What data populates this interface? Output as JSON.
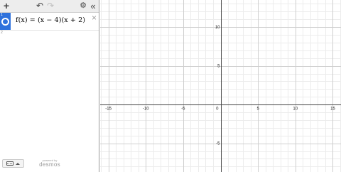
{
  "toolbar": {
    "add_icon": "plus-icon",
    "undo_icon": "undo-icon",
    "redo_icon": "redo-icon",
    "settings_icon": "gear-icon",
    "collapse_icon": "double-chevron-left-icon"
  },
  "expressions": [
    {
      "index": "1",
      "latex_text": "f(x) = (x − 4)(x + 2)",
      "color": "#2f72dc"
    }
  ],
  "next_index": "2",
  "footer": {
    "keyboard_icon": "keyboard-icon",
    "powered_by": "powered by",
    "brand": "desmos"
  },
  "graph": {
    "x_range": [
      -16.1,
      16.1
    ],
    "y_range": [
      -8.7,
      13.5
    ],
    "x_tick_labels": [
      "-15",
      "-10",
      "-5",
      "0",
      "5",
      "10",
      "15"
    ],
    "y_tick_labels": [
      "10",
      "5",
      "-5"
    ],
    "grid": true,
    "minor_gridlines": true
  }
}
